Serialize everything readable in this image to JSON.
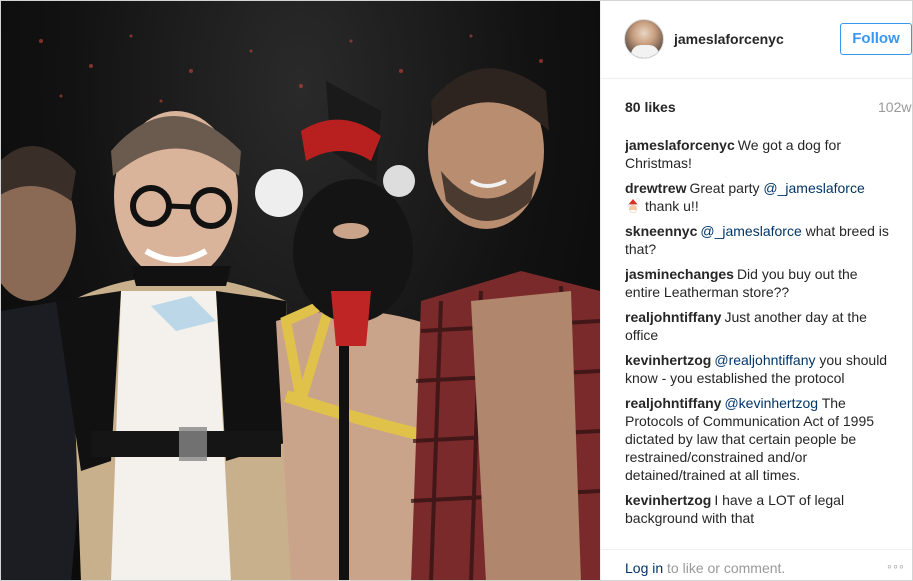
{
  "post": {
    "username": "jameslaforcenyc",
    "follow_label": "Follow",
    "likes": "80 likes",
    "age": "102w",
    "comments": [
      {
        "user": "jameslaforcenyc",
        "text": "We got a dog for Christmas!"
      },
      {
        "user": "drewtrew",
        "text_before": "Great party ",
        "mention": "@_jameslaforce",
        "emoji": "santa-emoji",
        "text_after": "thank u!!"
      },
      {
        "user": "skneennyc",
        "mention": "@_jameslaforce",
        "text": " what breed is that?"
      },
      {
        "user": "jasminechanges",
        "text": "Did you buy out the entire Leatherman store??"
      },
      {
        "user": "realjohntiffany",
        "text": "Just another day at the office"
      },
      {
        "user": "kevinhertzog",
        "mention": "@realjohntiffany",
        "text": " you should know - you established the protocol"
      },
      {
        "user": "realjohntiffany",
        "mention": "@kevinhertzog",
        "text": " The Protocols of Communication Act of 1995 dictated by law that certain people be restrained/constrained and/or detained/trained at all times."
      },
      {
        "user": "kevinhertzog",
        "text": "I have a LOT of legal background with that"
      }
    ],
    "footer": {
      "login_link": "Log in",
      "login_suffix": " to like or comment.",
      "more_icon": "more-options-icon",
      "more_glyph": "◦◦◦"
    }
  },
  "colors": {
    "accent": "#3897f0",
    "mention": "#003569",
    "muted": "#999999"
  }
}
